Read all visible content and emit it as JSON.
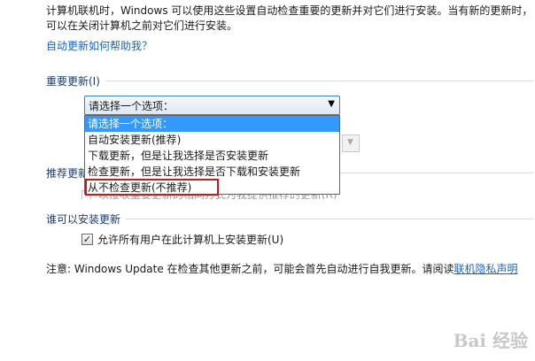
{
  "intro": {
    "line1": "计算机联机时，Windows 可以使用这些设置自动检查重要的更新并对它们进行安装。当有新的更新时，",
    "line2": "可以在关闭计算机之前对它们进行安装。"
  },
  "help_link": "自动更新如何帮助我？",
  "important_updates": {
    "header": "重要更新(I)",
    "selected_value": "请选择一个选项：",
    "options": [
      "请选择一个选项：",
      "自动安装更新(推荐)",
      "下载更新，但是让我选择是否安装更新",
      "检查更新，但是让我选择是否下载和安装更新",
      "从不检查更新(不推荐)"
    ]
  },
  "recommended_updates": {
    "header": "推荐更新",
    "checkbox_label_partial": "以接收重要更新的相同方式为我提供推荐的更新(R)"
  },
  "who_can_install": {
    "header": "谁可以安装更新",
    "checkbox_label": "允许所有用户在此计算机上安装更新(U)",
    "checked": true
  },
  "note": {
    "text": "注意: Windows Update 在检查其他更新之前，可能会首先自动进行自我更新。请阅读",
    "link": "联机隐私声明"
  },
  "watermark": "Bai 经验",
  "colors": {
    "link": "#1a64b4",
    "section_header": "#1d3b6b",
    "selection": "#3399ff",
    "highlight_border": "#c41a1a"
  }
}
